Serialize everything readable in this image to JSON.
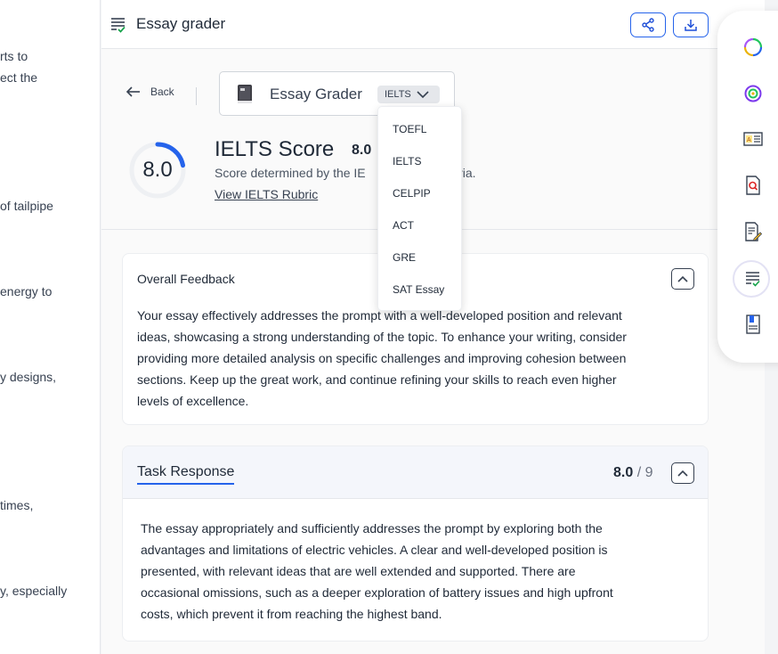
{
  "left_doc": {
    "fragments": [
      "rts to",
      "ect the",
      "of tailpipe",
      "energy to",
      "y designs,",
      "times,",
      "y, especially"
    ]
  },
  "topbar": {
    "title": "Essay grader",
    "share_icon": "share-icon",
    "download_icon": "download-icon"
  },
  "header": {
    "back_label": "Back",
    "grader_label": "Essay Grader",
    "selected_test": "IELTS"
  },
  "score": {
    "value": "8.0",
    "fraction": 0.22,
    "title": "IELTS Score",
    "badge": "8.0",
    "description_start": "Score determined by the IE",
    "description_end": "criteria.",
    "rubric_link": "View IELTS Rubric"
  },
  "dropdown": {
    "options": [
      "TOEFL",
      "IELTS",
      "CELPIP",
      "ACT",
      "GRE",
      "SAT Essay"
    ]
  },
  "overall_feedback": {
    "title": "Overall Feedback",
    "lines": [
      "Your essay effectively addresses the prompt with a well-developed position and relevant",
      "ideas, showcasing a strong understanding of the topic. To enhance your writing, consider",
      "providing more detailed analysis on specific challenges and improving cohesion between",
      "sections. Keep up the great work, and continue refining your skills to reach even higher",
      "levels of excellence."
    ]
  },
  "task_response": {
    "title": "Task Response",
    "score": "8.0",
    "max": "/ 9",
    "lines": [
      "The essay appropriately and sufficiently addresses the prompt by exploring both the",
      "advantages and limitations of electric vehicles. A clear and well-developed position is",
      "presented, with relevant ideas that are well extended and supported. There are",
      "occasional omissions, such as a deeper exploration of battery issues and high upfront",
      "costs, which prevent it from reaching the highest band."
    ]
  },
  "rail": {
    "icons": [
      "loading-ring-icon",
      "target-ring-icon",
      "reader-card-icon",
      "search-document-icon",
      "edit-document-icon",
      "essay-grader-icon",
      "notebook-icon"
    ]
  },
  "colors": {
    "accent": "#2563eb",
    "ring_track": "#eef0f3"
  }
}
